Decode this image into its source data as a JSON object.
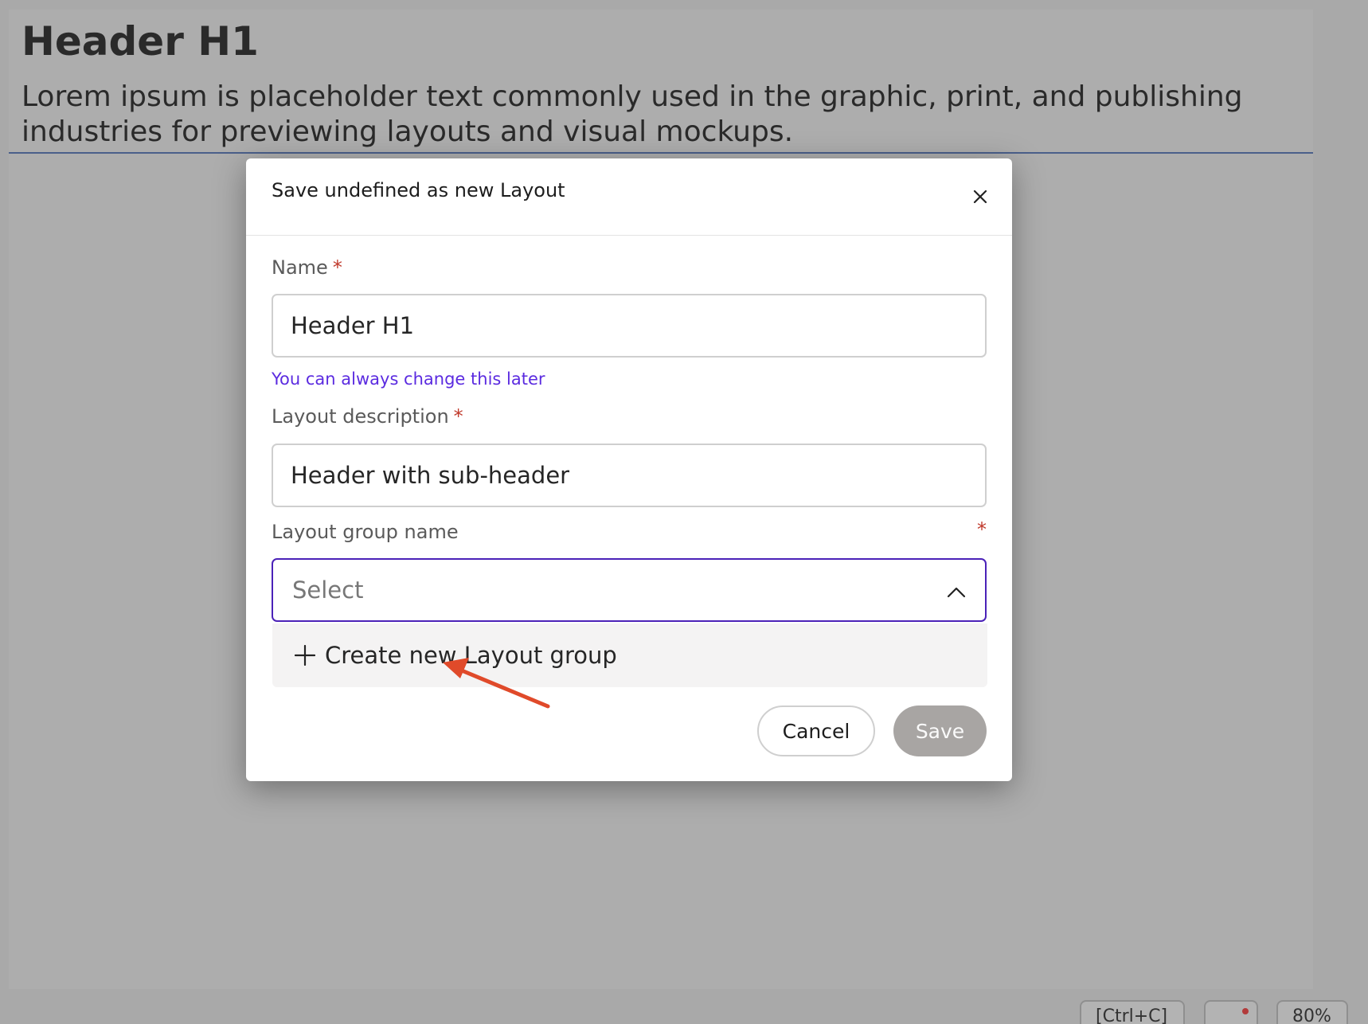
{
  "background": {
    "heading": "Header H1",
    "paragraph": "Lorem ipsum is placeholder text commonly used in the graphic, print, and publishing industries for previewing layouts and visual mockups.",
    "bottom_buttons": [
      "[Ctrl+C]",
      "",
      "80%"
    ]
  },
  "modal": {
    "title": "Save undefined as new Layout",
    "close_icon": "close-icon",
    "name_label": "Name",
    "name_value": "Header H1",
    "name_hint": "You can always change this later",
    "description_label": "Layout description",
    "description_value": "Header with sub-header",
    "group_label": "Layout group name",
    "required_mark": "*",
    "group_placeholder": "Select",
    "group_dropdown_icon": "chevron-up-icon",
    "dropdown_option": "Create new Layout group",
    "cancel_label": "Cancel",
    "save_label": "Save"
  },
  "colors": {
    "accent": "#4b22b8",
    "hint": "#5b2be0",
    "required": "#c0392b",
    "save_disabled": "#a8a5a3",
    "annotation_arrow": "#e04a2a"
  }
}
